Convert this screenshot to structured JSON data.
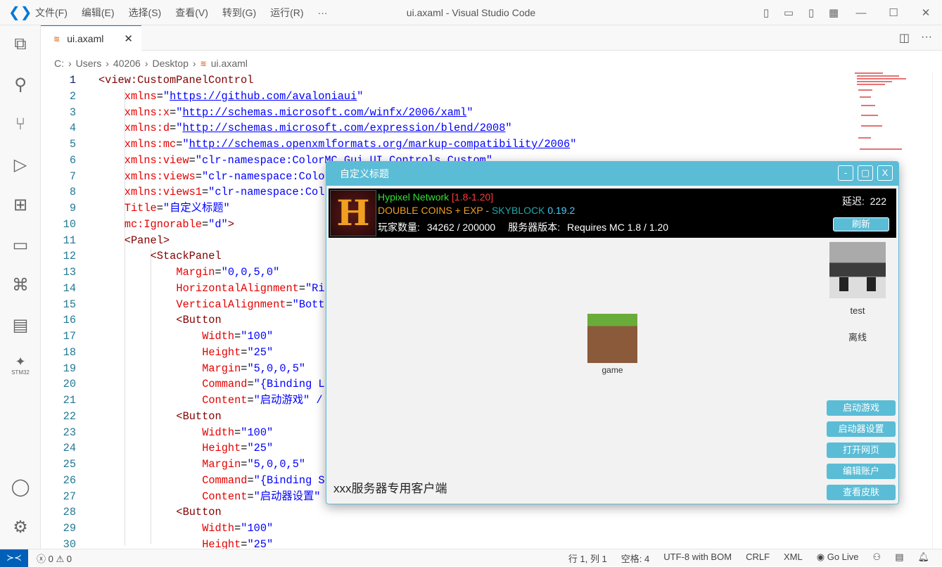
{
  "window": {
    "title": "ui.axaml - Visual Studio Code",
    "menu": [
      "文件(F)",
      "编辑(E)",
      "选择(S)",
      "查看(V)",
      "转到(G)",
      "运行(R)",
      "···"
    ]
  },
  "tab": {
    "label": "ui.axaml",
    "close": "✕"
  },
  "breadcrumb": [
    "C:",
    "Users",
    "40206",
    "Desktop",
    "ui.axaml"
  ],
  "code": [
    [
      0,
      [
        [
          "t",
          "<view:CustomPanelControl"
        ]
      ]
    ],
    [
      1,
      [
        [
          "a",
          "xmlns"
        ],
        [
          "e",
          "="
        ],
        [
          "s",
          "\""
        ],
        [
          "u",
          "https://github.com/avaloniaui"
        ],
        [
          "s",
          "\""
        ]
      ]
    ],
    [
      1,
      [
        [
          "a",
          "xmlns:x"
        ],
        [
          "e",
          "="
        ],
        [
          "s",
          "\""
        ],
        [
          "u",
          "http://schemas.microsoft.com/winfx/2006/xaml"
        ],
        [
          "s",
          "\""
        ]
      ]
    ],
    [
      1,
      [
        [
          "a",
          "xmlns:d"
        ],
        [
          "e",
          "="
        ],
        [
          "s",
          "\""
        ],
        [
          "u",
          "http://schemas.microsoft.com/expression/blend/2008"
        ],
        [
          "s",
          "\""
        ]
      ]
    ],
    [
      1,
      [
        [
          "a",
          "xmlns:mc"
        ],
        [
          "e",
          "="
        ],
        [
          "s",
          "\""
        ],
        [
          "u",
          "http://schemas.openxmlformats.org/markup-compatibility/2006"
        ],
        [
          "s",
          "\""
        ]
      ]
    ],
    [
      1,
      [
        [
          "a",
          "xmlns:view"
        ],
        [
          "e",
          "="
        ],
        [
          "s",
          "\"clr-namespace:ColorMC.Gui.UI.Controls.Custom\""
        ]
      ]
    ],
    [
      1,
      [
        [
          "a",
          "xmlns:views"
        ],
        [
          "e",
          "="
        ],
        [
          "s",
          "\"clr-namespace:Colo"
        ]
      ]
    ],
    [
      1,
      [
        [
          "a",
          "xmlns:views1"
        ],
        [
          "e",
          "="
        ],
        [
          "s",
          "\"clr-namespace:Col"
        ]
      ]
    ],
    [
      1,
      [
        [
          "a",
          "Title"
        ],
        [
          "e",
          "="
        ],
        [
          "s",
          "\"自定义标题\""
        ]
      ]
    ],
    [
      1,
      [
        [
          "a",
          "mc:Ignorable"
        ],
        [
          "e",
          "="
        ],
        [
          "s",
          "\"d\""
        ],
        [
          "t",
          ">"
        ]
      ]
    ],
    [
      1,
      [
        [
          "t",
          "<Panel>"
        ]
      ]
    ],
    [
      2,
      [
        [
          "t",
          "<StackPanel"
        ]
      ]
    ],
    [
      3,
      [
        [
          "a",
          "Margin"
        ],
        [
          "e",
          "="
        ],
        [
          "s",
          "\"0,0,5,0\""
        ]
      ]
    ],
    [
      3,
      [
        [
          "a",
          "HorizontalAlignment"
        ],
        [
          "e",
          "="
        ],
        [
          "s",
          "\"Ri"
        ]
      ]
    ],
    [
      3,
      [
        [
          "a",
          "VerticalAlignment"
        ],
        [
          "e",
          "="
        ],
        [
          "s",
          "\"Bott"
        ]
      ]
    ],
    [
      3,
      [
        [
          "t",
          "<Button"
        ]
      ]
    ],
    [
      4,
      [
        [
          "a",
          "Width"
        ],
        [
          "e",
          "="
        ],
        [
          "s",
          "\"100\""
        ]
      ]
    ],
    [
      4,
      [
        [
          "a",
          "Height"
        ],
        [
          "e",
          "="
        ],
        [
          "s",
          "\"25\""
        ]
      ]
    ],
    [
      4,
      [
        [
          "a",
          "Margin"
        ],
        [
          "e",
          "="
        ],
        [
          "s",
          "\"5,0,0,5\""
        ]
      ]
    ],
    [
      4,
      [
        [
          "a",
          "Command"
        ],
        [
          "e",
          "="
        ],
        [
          "s",
          "\"{Binding L"
        ]
      ]
    ],
    [
      4,
      [
        [
          "a",
          "Content"
        ],
        [
          "e",
          "="
        ],
        [
          "s",
          "\"启动游戏\" /"
        ]
      ]
    ],
    [
      3,
      [
        [
          "t",
          "<Button"
        ]
      ]
    ],
    [
      4,
      [
        [
          "a",
          "Width"
        ],
        [
          "e",
          "="
        ],
        [
          "s",
          "\"100\""
        ]
      ]
    ],
    [
      4,
      [
        [
          "a",
          "Height"
        ],
        [
          "e",
          "="
        ],
        [
          "s",
          "\"25\""
        ]
      ]
    ],
    [
      4,
      [
        [
          "a",
          "Margin"
        ],
        [
          "e",
          "="
        ],
        [
          "s",
          "\"5,0,0,5\""
        ]
      ]
    ],
    [
      4,
      [
        [
          "a",
          "Command"
        ],
        [
          "e",
          "="
        ],
        [
          "s",
          "\"{Binding S"
        ]
      ]
    ],
    [
      4,
      [
        [
          "a",
          "Content"
        ],
        [
          "e",
          "="
        ],
        [
          "s",
          "\"启动器设置\""
        ]
      ]
    ],
    [
      3,
      [
        [
          "t",
          "<Button"
        ]
      ]
    ],
    [
      4,
      [
        [
          "a",
          "Width"
        ],
        [
          "e",
          "="
        ],
        [
          "s",
          "\"100\""
        ]
      ]
    ],
    [
      4,
      [
        [
          "a",
          "Height"
        ],
        [
          "e",
          "="
        ],
        [
          "s",
          "\"25\""
        ]
      ]
    ]
  ],
  "status": {
    "errors": "0",
    "warnings": "0",
    "position": "行 1, 列 1",
    "spaces": "空格: 4",
    "encoding": "UTF-8 with BOM",
    "eol": "CRLF",
    "language": "XML",
    "golive": "Go Live"
  },
  "activity_extra": "STM32",
  "dialog": {
    "title": "自定义标题",
    "min": "-",
    "max": "▢",
    "close": "X",
    "server": {
      "name": "Hypixel Network",
      "version_range": "[1.8-1.20]",
      "motd1": "DOUBLE COINS + EXP",
      "motd_sep": " - ",
      "motd2": "SKYBLOCK",
      "motd3": "0.19.2",
      "players_label": "玩家数量:",
      "players": "34262 / 200000",
      "version_label": "服务器版本:",
      "version": "Requires MC 1.8 / 1.20",
      "ping_label": "延迟:",
      "ping": "222",
      "refresh": "刷新",
      "icon_letter": "H"
    },
    "user": {
      "name": "test",
      "state": "离线"
    },
    "game": {
      "label": "game"
    },
    "buttons": [
      "启动游戏",
      "启动器设置",
      "打开网页",
      "编辑账户",
      "查看皮肤"
    ],
    "footer": "xxx服务器专用客户端",
    "colors": {
      "accent": "#5bbcd6",
      "green": "#33e033",
      "red": "#ff3b3b",
      "orange": "#f0a020",
      "teal": "#20a8a8",
      "cyan": "#40d0ff"
    }
  }
}
